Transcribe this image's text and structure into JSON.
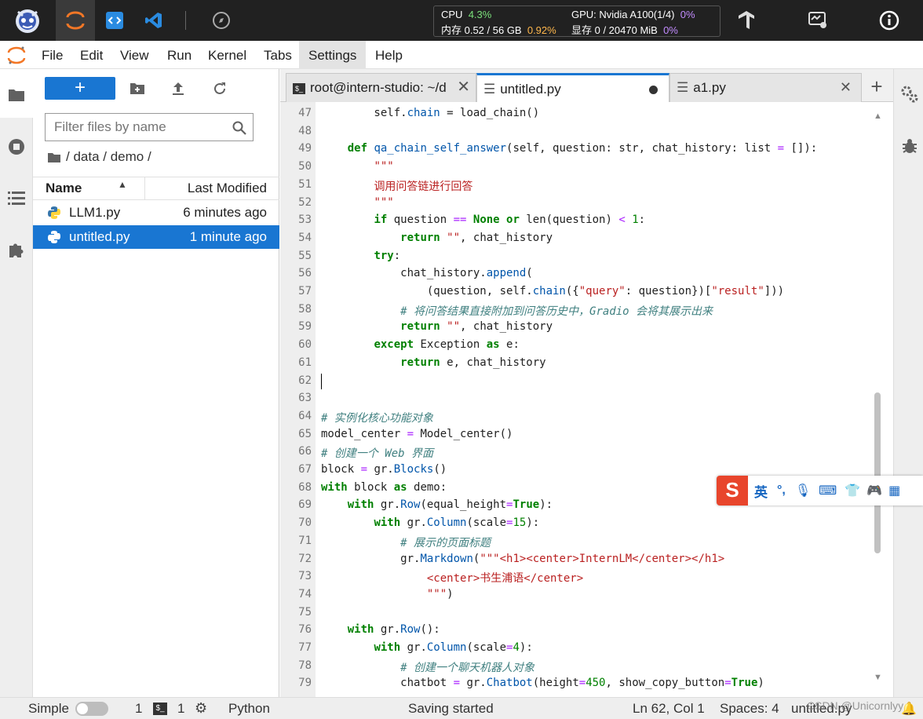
{
  "topbar": {
    "cpu_label": "CPU",
    "cpu_value": "4.3%",
    "mem_label": "内存 0.52 / 56 GB",
    "mem_value": "0.92%",
    "gpu_label": "GPU: Nvidia A100(1/4)",
    "gpu_value": "0%",
    "vram_label": "显存 0 / 20470 MiB",
    "vram_value": "0%"
  },
  "menu": [
    "File",
    "Edit",
    "View",
    "Run",
    "Kernel",
    "Tabs",
    "Settings",
    "Help"
  ],
  "filebrowser": {
    "new_label": "+",
    "filter_placeholder": "Filter files by name",
    "breadcrumb": "/ data / demo /",
    "col_name": "Name",
    "col_modified": "Last Modified",
    "files": [
      {
        "name": "LLM1.py",
        "modified": "6 minutes ago"
      },
      {
        "name": "untitled.py",
        "modified": "1 minute ago"
      }
    ]
  },
  "tabs": [
    {
      "label": "root@intern-studio: ~/d"
    },
    {
      "label": "untitled.py"
    },
    {
      "label": "a1.py"
    }
  ],
  "status": {
    "mode": "Simple",
    "terminals": "1",
    "kernels": "1",
    "kernel_name": "Python",
    "message": "Saving started",
    "cursor": "Ln 62, Col 1",
    "spaces": "Spaces: 4",
    "file": "untitled.py",
    "watermark": "CSDN @Unicornlyy"
  },
  "ime": {
    "lang": "英"
  },
  "code": [
    {
      "n": "47",
      "html": "        self.<span class=\"fn\">chain</span> = load_chain()"
    },
    {
      "n": "48",
      "html": ""
    },
    {
      "n": "49",
      "html": "    <span class=\"kw\">def</span> <span class=\"fn\">qa_chain_self_answer</span>(self, question: str, chat_history: list <span class=\"op\">=</span> []):"
    },
    {
      "n": "50",
      "html": "        <span class=\"st\">\"\"\"</span>"
    },
    {
      "n": "51",
      "html": "        <span class=\"st\">调用问答链进行回答</span>"
    },
    {
      "n": "52",
      "html": "        <span class=\"st\">\"\"\"</span>"
    },
    {
      "n": "53",
      "html": "        <span class=\"kw\">if</span> question <span class=\"op\">==</span> <span class=\"kw\">None</span> <span class=\"kw\">or</span> len(question) <span class=\"op\">&lt;</span> <span class=\"nm\">1</span>:"
    },
    {
      "n": "54",
      "html": "            <span class=\"kw\">return</span> <span class=\"st\">\"\"</span>, chat_history"
    },
    {
      "n": "55",
      "html": "        <span class=\"kw\">try</span>:"
    },
    {
      "n": "56",
      "html": "            chat_history.<span class=\"fn\">append</span>("
    },
    {
      "n": "57",
      "html": "                (question, self.<span class=\"fn\">chain</span>({<span class=\"st\">\"query\"</span>: question})[<span class=\"st\">\"result\"</span>]))"
    },
    {
      "n": "58",
      "html": "            <span class=\"cm\"># 将问答结果直接附加到问答历史中，Gradio 会将其展示出来</span>"
    },
    {
      "n": "59",
      "html": "            <span class=\"kw\">return</span> <span class=\"st\">\"\"</span>, chat_history"
    },
    {
      "n": "60",
      "html": "        <span class=\"kw\">except</span> Exception <span class=\"kw\">as</span> e:"
    },
    {
      "n": "61",
      "html": "            <span class=\"kw\">return</span> e, chat_history"
    },
    {
      "n": "62",
      "html": ""
    },
    {
      "n": "63",
      "html": ""
    },
    {
      "n": "64",
      "html": "<span class=\"cm\"># 实例化核心功能对象</span>"
    },
    {
      "n": "65",
      "html": "model_center <span class=\"op\">=</span> Model_center()"
    },
    {
      "n": "66",
      "html": "<span class=\"cm\"># 创建一个 Web 界面</span>"
    },
    {
      "n": "67",
      "html": "block <span class=\"op\">=</span> gr.<span class=\"fn\">Blocks</span>()"
    },
    {
      "n": "68",
      "html": "<span class=\"kw\">with</span> block <span class=\"kw\">as</span> demo:"
    },
    {
      "n": "69",
      "html": "    <span class=\"kw\">with</span> gr.<span class=\"fn\">Row</span>(equal_height<span class=\"op\">=</span><span class=\"kw\">True</span>):"
    },
    {
      "n": "70",
      "html": "        <span class=\"kw\">with</span> gr.<span class=\"fn\">Column</span>(scale<span class=\"op\">=</span><span class=\"nm\">15</span>):"
    },
    {
      "n": "71",
      "html": "            <span class=\"cm\"># 展示的页面标题</span>"
    },
    {
      "n": "72",
      "html": "            gr.<span class=\"fn\">Markdown</span>(<span class=\"st\">\"\"\"&lt;h1&gt;&lt;center&gt;InternLM&lt;/center&gt;&lt;/h1&gt;</span>"
    },
    {
      "n": "73",
      "html": "<span class=\"st\">                &lt;center&gt;书生浦语&lt;/center&gt;</span>"
    },
    {
      "n": "74",
      "html": "<span class=\"st\">                \"\"\"</span>)"
    },
    {
      "n": "75",
      "html": ""
    },
    {
      "n": "76",
      "html": "    <span class=\"kw\">with</span> gr.<span class=\"fn\">Row</span>():"
    },
    {
      "n": "77",
      "html": "        <span class=\"kw\">with</span> gr.<span class=\"fn\">Column</span>(scale<span class=\"op\">=</span><span class=\"nm\">4</span>):"
    },
    {
      "n": "78",
      "html": "            <span class=\"cm\"># 创建一个聊天机器人对象</span>"
    },
    {
      "n": "79",
      "html": "            chatbot <span class=\"op\">=</span> gr.<span class=\"fn\">Chatbot</span>(height<span class=\"op\">=</span><span class=\"nm\">450</span>, show_copy_button<span class=\"op\">=</span><span class=\"kw\">True</span>)"
    }
  ]
}
